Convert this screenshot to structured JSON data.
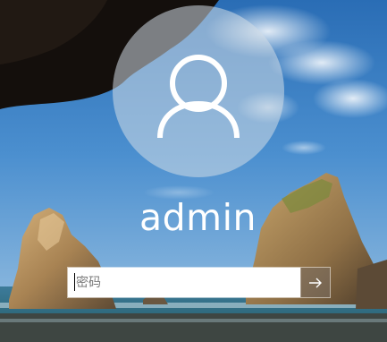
{
  "user": {
    "name": "admin"
  },
  "password": {
    "placeholder": "密码",
    "value": ""
  },
  "icons": {
    "avatar": "user-silhouette-icon",
    "submit": "arrow-right-icon"
  },
  "colors": {
    "avatar_circle": "#c7d3dd",
    "text": "#ffffff",
    "submit_bg": "#8a7f74"
  }
}
